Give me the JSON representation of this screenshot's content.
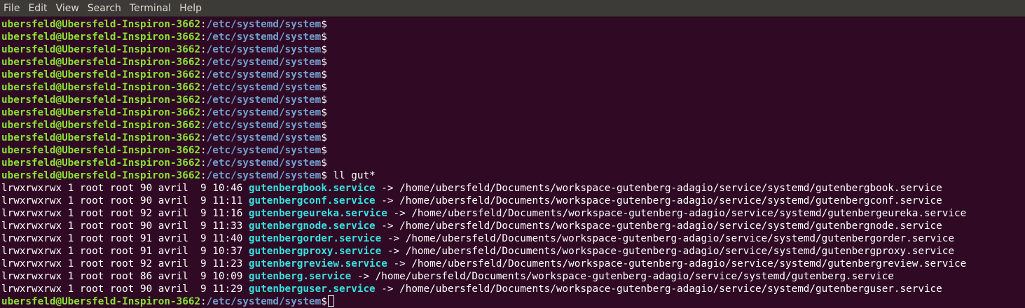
{
  "menu": {
    "items": [
      "File",
      "Edit",
      "View",
      "Search",
      "Terminal",
      "Help"
    ]
  },
  "prompt": {
    "user_host": "ubersfeld@Ubersfeld-Inspiron-3662",
    "colon": ":",
    "path": "/etc/systemd/system",
    "dollar": "$"
  },
  "terminal": {
    "empty_prompt_count": 12,
    "command": " ll gut*",
    "listing": [
      {
        "meta": "lrwxrwxrwx 1 root root 90 avril  9 10:46 ",
        "name": "gutenbergbook.service",
        "target": " -> /home/ubersfeld/Documents/workspace-gutenberg-adagio/service/systemd/gutenbergbook.service"
      },
      {
        "meta": "lrwxrwxrwx 1 root root 90 avril  9 11:11 ",
        "name": "gutenbergconf.service",
        "target": " -> /home/ubersfeld/Documents/workspace-gutenberg-adagio/service/systemd/gutenbergconf.service"
      },
      {
        "meta": "lrwxrwxrwx 1 root root 92 avril  9 11:16 ",
        "name": "gutenbergeureka.service",
        "target": " -> /home/ubersfeld/Documents/workspace-gutenberg-adagio/service/systemd/gutenbergeureka.service"
      },
      {
        "meta": "lrwxrwxrwx 1 root root 90 avril  9 11:33 ",
        "name": "gutenbergnode.service",
        "target": " -> /home/ubersfeld/Documents/workspace-gutenberg-adagio/service/systemd/gutenbergnode.service"
      },
      {
        "meta": "lrwxrwxrwx 1 root root 91 avril  9 11:40 ",
        "name": "gutenbergorder.service",
        "target": " -> /home/ubersfeld/Documents/workspace-gutenberg-adagio/service/systemd/gutenbergorder.service"
      },
      {
        "meta": "lrwxrwxrwx 1 root root 91 avril  9 10:37 ",
        "name": "gutenbergproxy.service",
        "target": " -> /home/ubersfeld/Documents/workspace-gutenberg-adagio/service/systemd/gutenbergproxy.service"
      },
      {
        "meta": "lrwxrwxrwx 1 root root 92 avril  9 11:23 ",
        "name": "gutenbergreview.service",
        "target": " -> /home/ubersfeld/Documents/workspace-gutenberg-adagio/service/systemd/gutenbergreview.service"
      },
      {
        "meta": "lrwxrwxrwx 1 root root 86 avril  9 10:09 ",
        "name": "gutenberg.service",
        "target": " -> /home/ubersfeld/Documents/workspace-gutenberg-adagio/service/systemd/gutenberg.service"
      },
      {
        "meta": "lrwxrwxrwx 1 root root 90 avril  9 11:29 ",
        "name": "gutenberguser.service",
        "target": " -> /home/ubersfeld/Documents/workspace-gutenberg-adagio/service/systemd/gutenberguser.service"
      }
    ]
  },
  "colors": {
    "background": "#300a24",
    "menubar": "#3c3b37",
    "user_host": "#8ae234",
    "path": "#729fcf",
    "symlink": "#34e2e2",
    "text": "#ffffff"
  }
}
